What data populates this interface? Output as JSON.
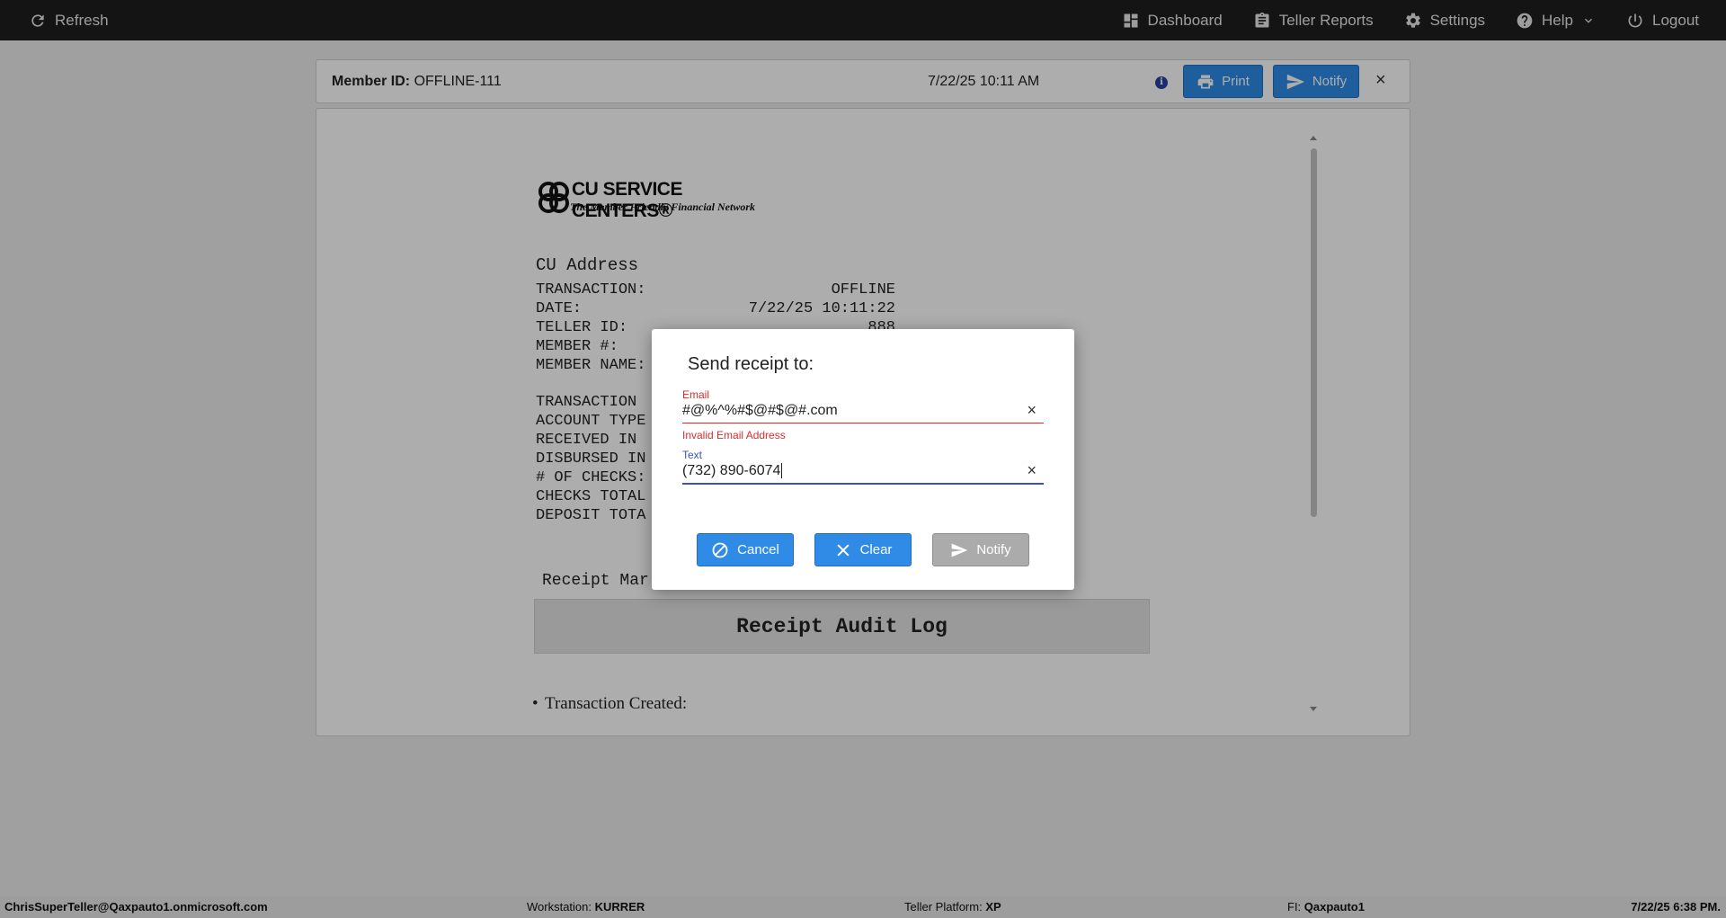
{
  "topbar": {
    "refresh": "Refresh",
    "dashboard": "Dashboard",
    "teller_reports": "Teller Reports",
    "settings": "Settings",
    "help": "Help",
    "logout": "Logout"
  },
  "receipt_header": {
    "member_label": "Member ID:",
    "member_id": "OFFLINE-111",
    "datetime": "7/22/25 10:11 AM",
    "info_icon": "i",
    "print_label": "Print",
    "notify_label": "Notify",
    "close": "×"
  },
  "receipt": {
    "logo_main": "CU SERVICE CENTERS®",
    "logo_sub": "The Member Friendly Financial Network",
    "address": "CU Address",
    "lines": [
      {
        "key": "TRANSACTION:",
        "value": "OFFLINE"
      },
      {
        "key": "DATE:",
        "value": "7/22/25 10:11:22"
      },
      {
        "key": "TELLER ID:",
        "value": "888"
      },
      {
        "key": "MEMBER #:",
        "value": ""
      },
      {
        "key": "MEMBER NAME:",
        "value": ""
      },
      {
        "key": "",
        "value": ""
      },
      {
        "key": "TRANSACTION",
        "value": ""
      },
      {
        "key": "ACCOUNT TYPE",
        "value": ""
      },
      {
        "key": "RECEIVED IN",
        "value": ""
      },
      {
        "key": "DISBURSED IN",
        "value": ""
      },
      {
        "key": "# OF CHECKS:",
        "value": ""
      },
      {
        "key": "CHECKS TOTAL",
        "value": ""
      },
      {
        "key": "DEPOSIT TOTA",
        "value": ""
      }
    ],
    "receipt_marks": "Receipt Mar",
    "audit_log": "Receipt Audit Log",
    "bullet": "Transaction Created:"
  },
  "dialog": {
    "title": "Send receipt to:",
    "email_label": "Email",
    "email_value": "#@%^%#$@#$@#.com",
    "email_error": "Invalid Email Address",
    "text_label": "Text",
    "text_value": "(732) 890-6074",
    "clear_x": "×",
    "cancel": "Cancel",
    "clear": "Clear",
    "notify": "Notify"
  },
  "status": {
    "user": "ChrisSuperTeller@Qaxpauto1.onmicrosoft.com",
    "workstation_label": "Workstation:",
    "workstation": "KURRER",
    "platform_label": "Teller Platform:",
    "platform": "XP",
    "fi_label": "FI:",
    "fi": "Qaxpauto1",
    "datetime": "7/22/25 6:38 PM."
  }
}
